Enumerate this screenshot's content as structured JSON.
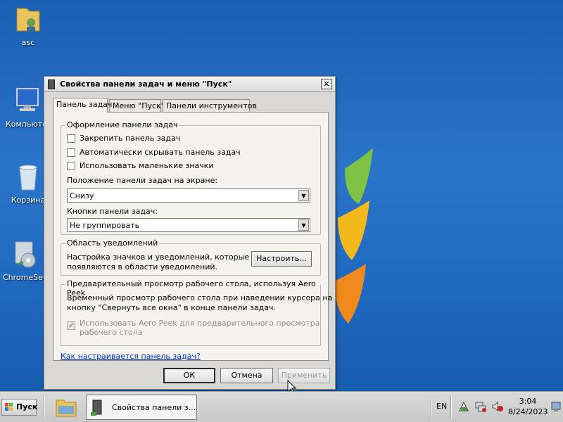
{
  "desktop": {
    "icons": [
      {
        "label": "asc",
        "icon": "user-folder-icon"
      },
      {
        "label": "Компьютер",
        "icon": "computer-icon"
      },
      {
        "label": "Корзина",
        "icon": "recycle-bin-icon"
      },
      {
        "label": "ChromeSetup",
        "icon": "installer-icon"
      }
    ]
  },
  "dialog": {
    "title": "Свойства панели задач и меню \"Пуск\"",
    "close_label": "✕",
    "tabs": [
      "Панель задач",
      "Меню \"Пуск\"",
      "Панели инструментов"
    ],
    "active_tab": "Панель задач",
    "appearance_group": {
      "title": "Оформление панели задач",
      "checkboxes": [
        {
          "label": "Закрепить панель задач",
          "checked": false
        },
        {
          "label": "Автоматически скрывать панель задач",
          "checked": false
        },
        {
          "label": "Использовать маленькие значки",
          "checked": false
        }
      ],
      "position_label": "Положение панели задач на экране:",
      "position_value": "Снизу",
      "buttons_label": "Кнопки панели задач:",
      "buttons_value": "Не группировать"
    },
    "notify_group": {
      "title": "Область уведомлений",
      "text_line1": "Настройка значков и уведомлений, которые",
      "text_line2": "появляются в области уведомлений.",
      "customize_label": "Настроить..."
    },
    "peek_group": {
      "title": "Предварительный просмотр рабочего стола, используя Aero Peek",
      "text_line1": "Временный просмотр рабочего стола при наведении курсора на",
      "text_line2": "кнопку \"Свернуть все окна\" в конце панели задач.",
      "checkbox_line1": "Использовать Aero Peek для предварительного просмотра",
      "checkbox_line2": "рабочего стола",
      "checkbox_checked": true
    },
    "help_link": "Как настраивается панель задач?",
    "ok_label": "ОК",
    "cancel_label": "Отмена",
    "apply_label": "Применить"
  },
  "taskbar": {
    "start_label": "Пуск",
    "task_label": "Свойства панели з...",
    "lang": "EN",
    "time": "3:04",
    "date": "8/24/2023"
  }
}
